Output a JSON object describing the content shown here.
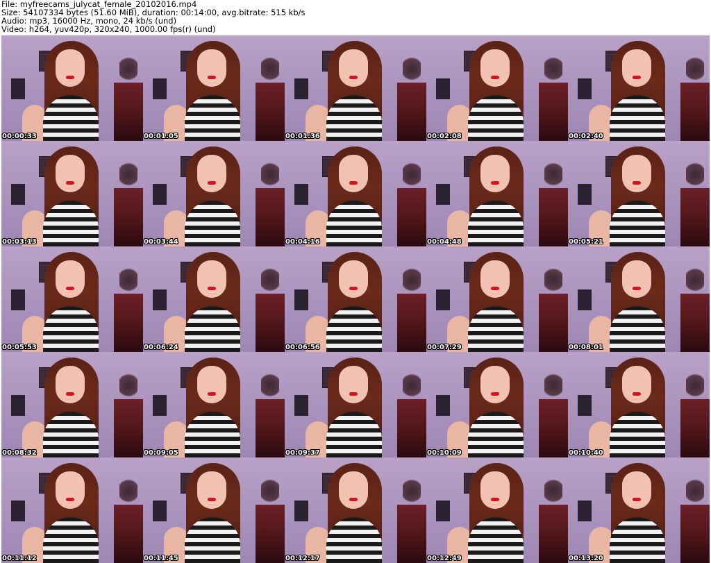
{
  "header": {
    "file_line": "File: myfreecams_julycat_female_20102016.mp4",
    "size_line": "Size: 54107334 bytes (51.60 MiB), duration: 00:14:00, avg.bitrate: 515 kb/s",
    "audio_line": "Audio: mp3, 16000 Hz, mono, 24 kb/s (und)",
    "video_line": "Video: h264, yuv420p, 320x240, 1000.00 fps(r) (und)"
  },
  "thumbnails": [
    {
      "timestamp": "00:00:33"
    },
    {
      "timestamp": "00:01:05"
    },
    {
      "timestamp": "00:01:36"
    },
    {
      "timestamp": "00:02:08"
    },
    {
      "timestamp": "00:02:40"
    },
    {
      "timestamp": "00:03:13"
    },
    {
      "timestamp": "00:03:44"
    },
    {
      "timestamp": "00:04:16"
    },
    {
      "timestamp": "00:04:48"
    },
    {
      "timestamp": "00:05:21"
    },
    {
      "timestamp": "00:05:53"
    },
    {
      "timestamp": "00:06:24"
    },
    {
      "timestamp": "00:06:56"
    },
    {
      "timestamp": "00:07:29"
    },
    {
      "timestamp": "00:08:01"
    },
    {
      "timestamp": "00:08:32"
    },
    {
      "timestamp": "00:09:05"
    },
    {
      "timestamp": "00:09:37"
    },
    {
      "timestamp": "00:10:09"
    },
    {
      "timestamp": "00:10:40"
    },
    {
      "timestamp": "00:11:12"
    },
    {
      "timestamp": "00:11:45"
    },
    {
      "timestamp": "00:12:17"
    },
    {
      "timestamp": "00:12:49"
    },
    {
      "timestamp": "00:13:20"
    }
  ]
}
